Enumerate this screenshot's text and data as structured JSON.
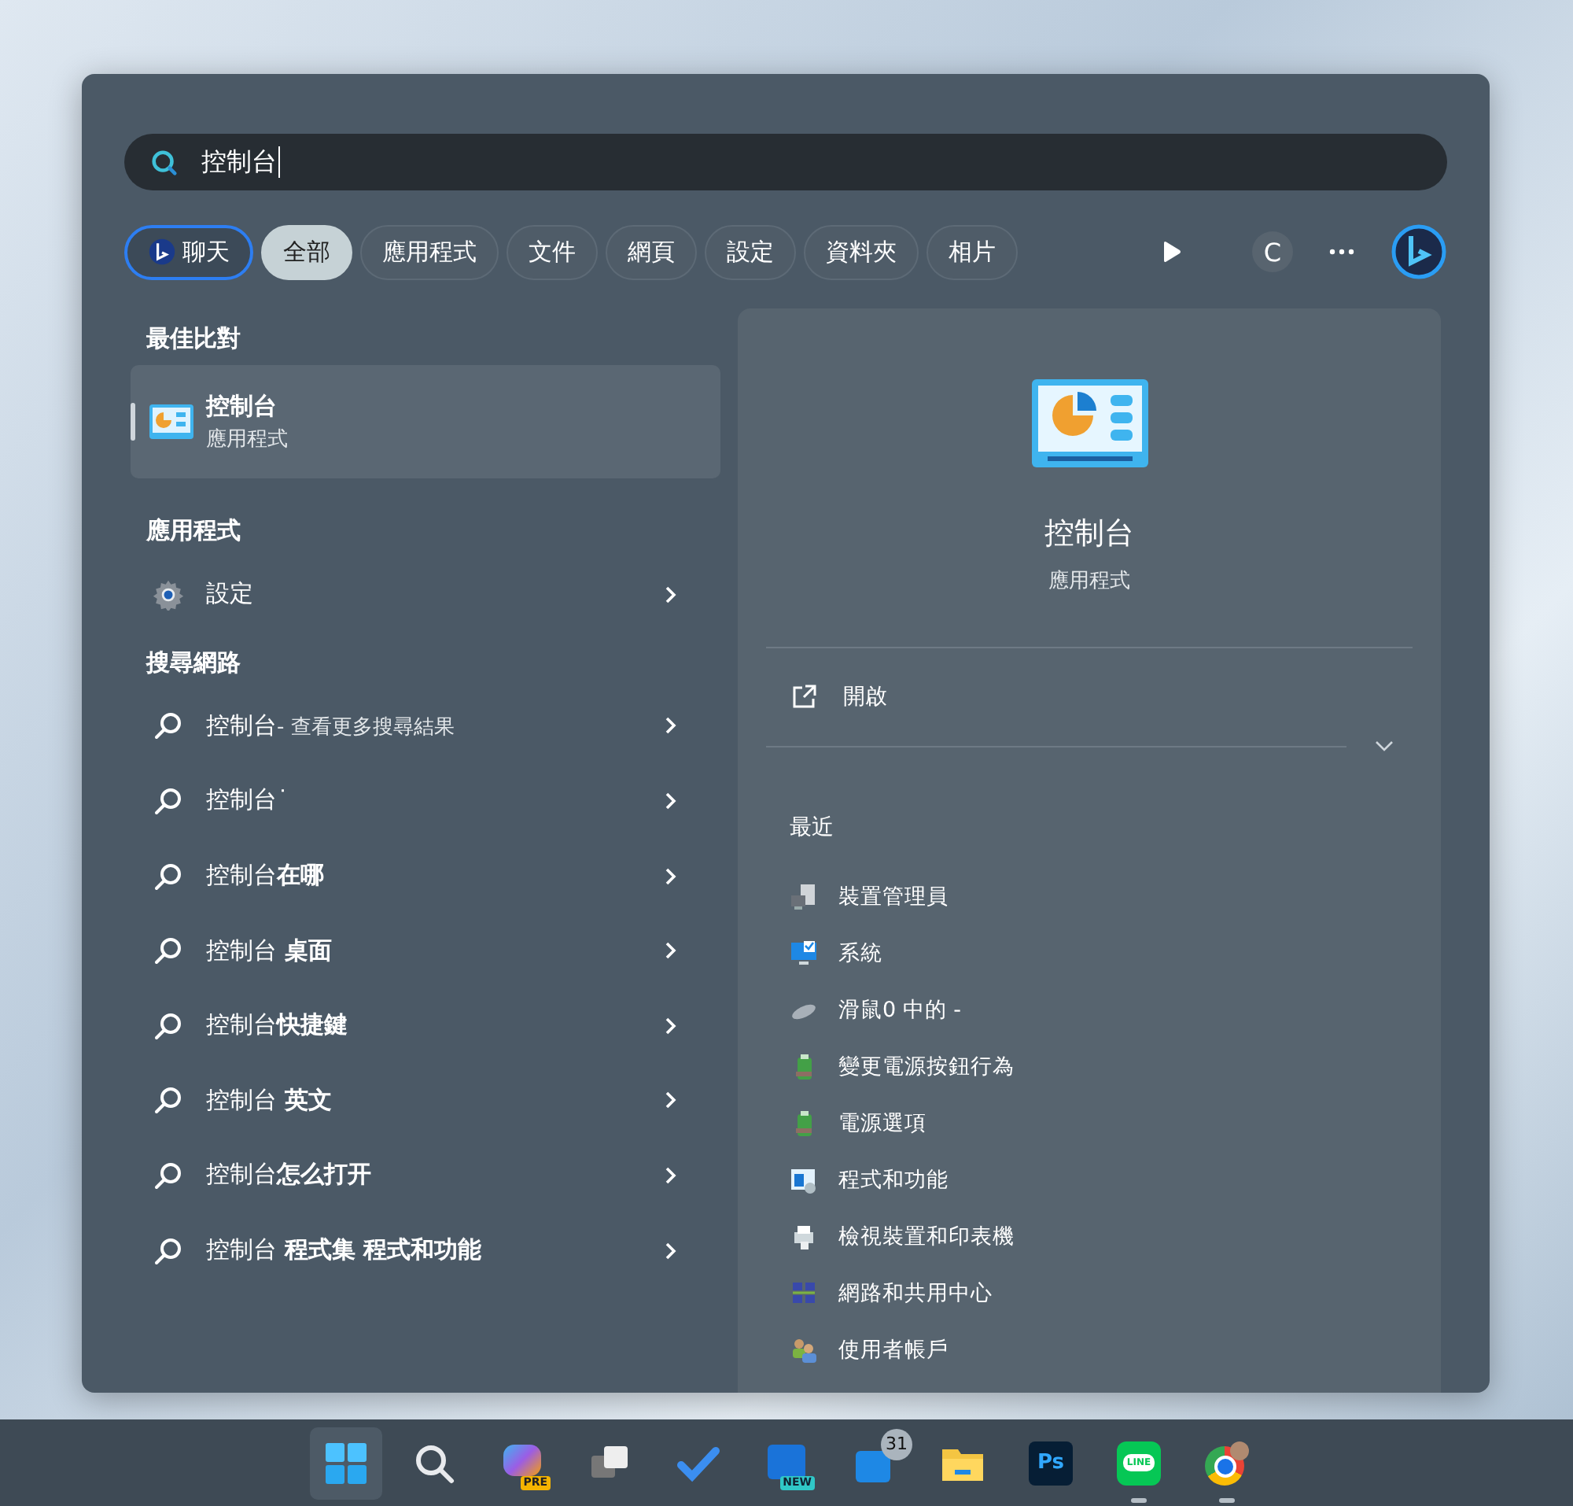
{
  "search": {
    "value": "控制台"
  },
  "filters": [
    {
      "kind": "chat",
      "label": "聊天",
      "selected": false
    },
    {
      "kind": "tab",
      "label": "全部",
      "selected": true
    },
    {
      "kind": "tab",
      "label": "應用程式",
      "selected": false
    },
    {
      "kind": "tab",
      "label": "文件",
      "selected": false
    },
    {
      "kind": "tab",
      "label": "網頁",
      "selected": false
    },
    {
      "kind": "tab",
      "label": "設定",
      "selected": false
    },
    {
      "kind": "tab",
      "label": "資料夾",
      "selected": false
    },
    {
      "kind": "tab",
      "label": "相片",
      "selected": false
    }
  ],
  "account_initial": "C",
  "best_match": {
    "heading": "最佳比對",
    "title": "控制台",
    "subtitle": "應用程式",
    "selected": true
  },
  "apps": {
    "heading": "應用程式",
    "items": [
      {
        "label": "設定"
      }
    ]
  },
  "web": {
    "heading": "搜尋網路",
    "items": [
      {
        "text": "控制台",
        "note": "- 查看更多搜尋結果"
      },
      {
        "text": "控制台˙"
      },
      {
        "text": "控制台**在哪**"
      },
      {
        "text": "控制台 **桌面**"
      },
      {
        "text": "控制台**快捷鍵**"
      },
      {
        "text": "控制台 **英文**"
      },
      {
        "text": "控制台**怎么打开**"
      },
      {
        "text": "控制台 **程式集 程式和功能**"
      }
    ]
  },
  "detail": {
    "title": "控制台",
    "subtitle": "應用程式",
    "open_label": "開啟",
    "recent_heading": "最近",
    "recent": [
      {
        "kind": "device-manager",
        "label": "裝置管理員"
      },
      {
        "kind": "system",
        "label": "系統"
      },
      {
        "kind": "mouse",
        "label": "滑鼠0 中的 -"
      },
      {
        "kind": "power",
        "label": "變更電源按鈕行為"
      },
      {
        "kind": "power",
        "label": "電源選項"
      },
      {
        "kind": "programs",
        "label": "程式和功能"
      },
      {
        "kind": "printer",
        "label": "檢視裝置和印表機"
      },
      {
        "kind": "network",
        "label": "網路和共用中心"
      },
      {
        "kind": "users",
        "label": "使用者帳戶"
      }
    ]
  },
  "taskbar": [
    {
      "kind": "start",
      "selected": true,
      "running": false
    },
    {
      "kind": "search",
      "selected": false,
      "running": false
    },
    {
      "kind": "copilot",
      "label": "PRE",
      "selected": false,
      "running": false
    },
    {
      "kind": "taskview",
      "selected": false,
      "running": false
    },
    {
      "kind": "todo",
      "selected": false,
      "running": false
    },
    {
      "kind": "outlook",
      "label": "NEW",
      "selected": false,
      "running": false
    },
    {
      "kind": "mail",
      "badge": "31",
      "selected": false,
      "running": false
    },
    {
      "kind": "folder",
      "selected": false,
      "running": false
    },
    {
      "kind": "ps",
      "label": "Ps",
      "selected": false,
      "running": false
    },
    {
      "kind": "line",
      "label": "LINE",
      "selected": false,
      "running": true
    },
    {
      "kind": "chrome",
      "selected": false,
      "running": true
    }
  ]
}
